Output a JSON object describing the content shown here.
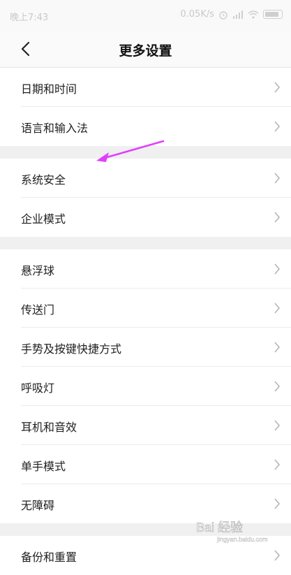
{
  "status": {
    "time": "晚上7:43",
    "speed": "0.05K/s",
    "icons": [
      "alarm-icon",
      "signal-icon",
      "wifi-icon",
      "battery-icon"
    ]
  },
  "header": {
    "title": "更多设置",
    "back_icon": "back-arrow-icon"
  },
  "groups": [
    {
      "items": [
        "日期和时间",
        "语言和输入法"
      ]
    },
    {
      "items": [
        "系统安全",
        "企业模式"
      ]
    },
    {
      "items": [
        "悬浮球",
        "传送门",
        "手势及按键快捷方式",
        "呼吸灯",
        "耳机和音效",
        "单手模式",
        "无障碍"
      ]
    },
    {
      "items": [
        "备份和重置"
      ]
    }
  ],
  "annotation": {
    "arrow_color": "#e040fb"
  },
  "watermark": {
    "text": "Bai 经验",
    "subtext": "jingyan.baidu.com"
  }
}
